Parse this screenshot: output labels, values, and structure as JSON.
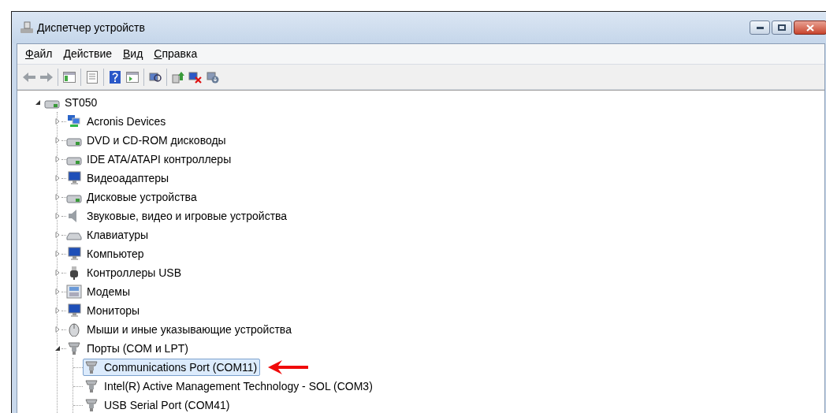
{
  "window": {
    "title": "Диспетчер устройств"
  },
  "menu": [
    "Файл",
    "Действие",
    "Вид",
    "Справка"
  ],
  "tree": {
    "label": "ST050",
    "expanded": true,
    "children": [
      {
        "label": "Acronis Devices",
        "expanded": false
      },
      {
        "label": "DVD и CD-ROM дисководы",
        "expanded": false
      },
      {
        "label": "IDE ATA/ATAPI контроллеры",
        "expanded": false
      },
      {
        "label": "Видеоадаптеры",
        "expanded": false
      },
      {
        "label": "Дисковые устройства",
        "expanded": false
      },
      {
        "label": "Звуковые, видео и игровые устройства",
        "expanded": false
      },
      {
        "label": "Клавиатуры",
        "expanded": false
      },
      {
        "label": "Компьютер",
        "expanded": false
      },
      {
        "label": "Контроллеры USB",
        "expanded": false
      },
      {
        "label": "Модемы",
        "expanded": false
      },
      {
        "label": "Мониторы",
        "expanded": false
      },
      {
        "label": "Мыши и иные указывающие устройства",
        "expanded": false
      },
      {
        "label": "Порты (COM и LPT)",
        "expanded": true,
        "children": [
          {
            "label": "Communications Port (COM11)",
            "selected": true
          },
          {
            "label": "Intel(R) Active Management Technology - SOL (COM3)",
            "selected": false
          },
          {
            "label": "USB Serial Port (COM41)",
            "selected": false
          }
        ]
      }
    ]
  }
}
